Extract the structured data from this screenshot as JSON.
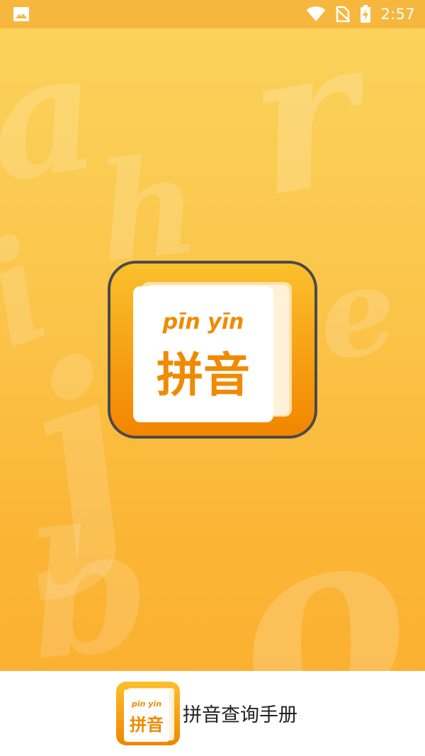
{
  "status_bar": {
    "time": "2:57",
    "icons": [
      "image-icon",
      "wifi-icon",
      "no-sim-icon",
      "battery-charging-icon"
    ]
  },
  "splash": {
    "background_letters": [
      "a",
      "h",
      "r",
      "i",
      "e",
      "j",
      "b",
      "o"
    ],
    "logo": {
      "pinyin": "pīn yīn",
      "hanzi": "拼音"
    }
  },
  "footer": {
    "app_name": "拼音查询手册",
    "logo": {
      "pinyin": "pīn yīn",
      "hanzi": "拼音"
    }
  },
  "colors": {
    "status_bar": "#f6b73f",
    "gradient_top": "#fbd25a",
    "gradient_bottom": "#fbb132",
    "logo_orange": "#f08a00",
    "logo_border": "#4a4a4a"
  }
}
